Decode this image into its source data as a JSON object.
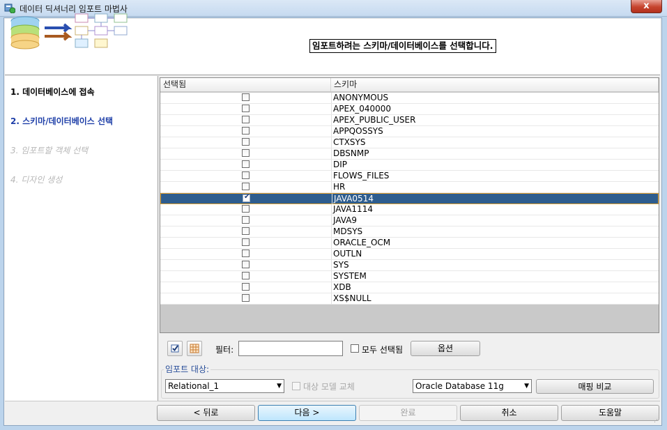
{
  "window": {
    "title": "데이터 딕셔너리 임포트 마법사",
    "close_label": "x"
  },
  "header": {
    "message": "임포트하려는 스키마/데이터베이스를 선택합니다."
  },
  "steps": [
    {
      "label": "1. 데이터베이스에 접속",
      "state": "done"
    },
    {
      "label": "2. 스키마/데이터베이스 선택",
      "state": "current"
    },
    {
      "label": "3. 임포트할 객체 선택",
      "state": "disabled"
    },
    {
      "label": "4. 디자인 생성",
      "state": "disabled"
    }
  ],
  "table": {
    "columns": [
      "선택됨",
      "스키마"
    ],
    "rows": [
      {
        "name": "ANONYMOUS",
        "checked": false,
        "selected": false
      },
      {
        "name": "APEX_040000",
        "checked": false,
        "selected": false
      },
      {
        "name": "APEX_PUBLIC_USER",
        "checked": false,
        "selected": false
      },
      {
        "name": "APPQOSSYS",
        "checked": false,
        "selected": false
      },
      {
        "name": "CTXSYS",
        "checked": false,
        "selected": false
      },
      {
        "name": "DBSNMP",
        "checked": false,
        "selected": false
      },
      {
        "name": "DIP",
        "checked": false,
        "selected": false
      },
      {
        "name": "FLOWS_FILES",
        "checked": false,
        "selected": false
      },
      {
        "name": "HR",
        "checked": false,
        "selected": false
      },
      {
        "name": "JAVA0514",
        "checked": true,
        "selected": true
      },
      {
        "name": "JAVA1114",
        "checked": false,
        "selected": false
      },
      {
        "name": "JAVA9",
        "checked": false,
        "selected": false
      },
      {
        "name": "MDSYS",
        "checked": false,
        "selected": false
      },
      {
        "name": "ORACLE_OCM",
        "checked": false,
        "selected": false
      },
      {
        "name": "OUTLN",
        "checked": false,
        "selected": false
      },
      {
        "name": "SYS",
        "checked": false,
        "selected": false
      },
      {
        "name": "SYSTEM",
        "checked": false,
        "selected": false
      },
      {
        "name": "XDB",
        "checked": false,
        "selected": false
      },
      {
        "name": "XS$NULL",
        "checked": false,
        "selected": false
      }
    ]
  },
  "controls": {
    "filter_label": "필터:",
    "filter_value": "",
    "all_selected_label": "모두 선택됨",
    "options_label": "옵션"
  },
  "import_target": {
    "group_label": "임포트 대상:",
    "relational_value": "Relational_1",
    "replace_label": "대상 모델 교체",
    "db_value": "Oracle Database 11g",
    "compare_label": "매핑 비교"
  },
  "footer": {
    "back": "< 뒤로",
    "next": "다음 >",
    "finish": "완료",
    "cancel": "취소",
    "help": "도움말"
  },
  "colors": {
    "selected_row": "#2e5d8e",
    "current_step": "#1e3fa8",
    "disabled_text": "#b8b8b8"
  }
}
